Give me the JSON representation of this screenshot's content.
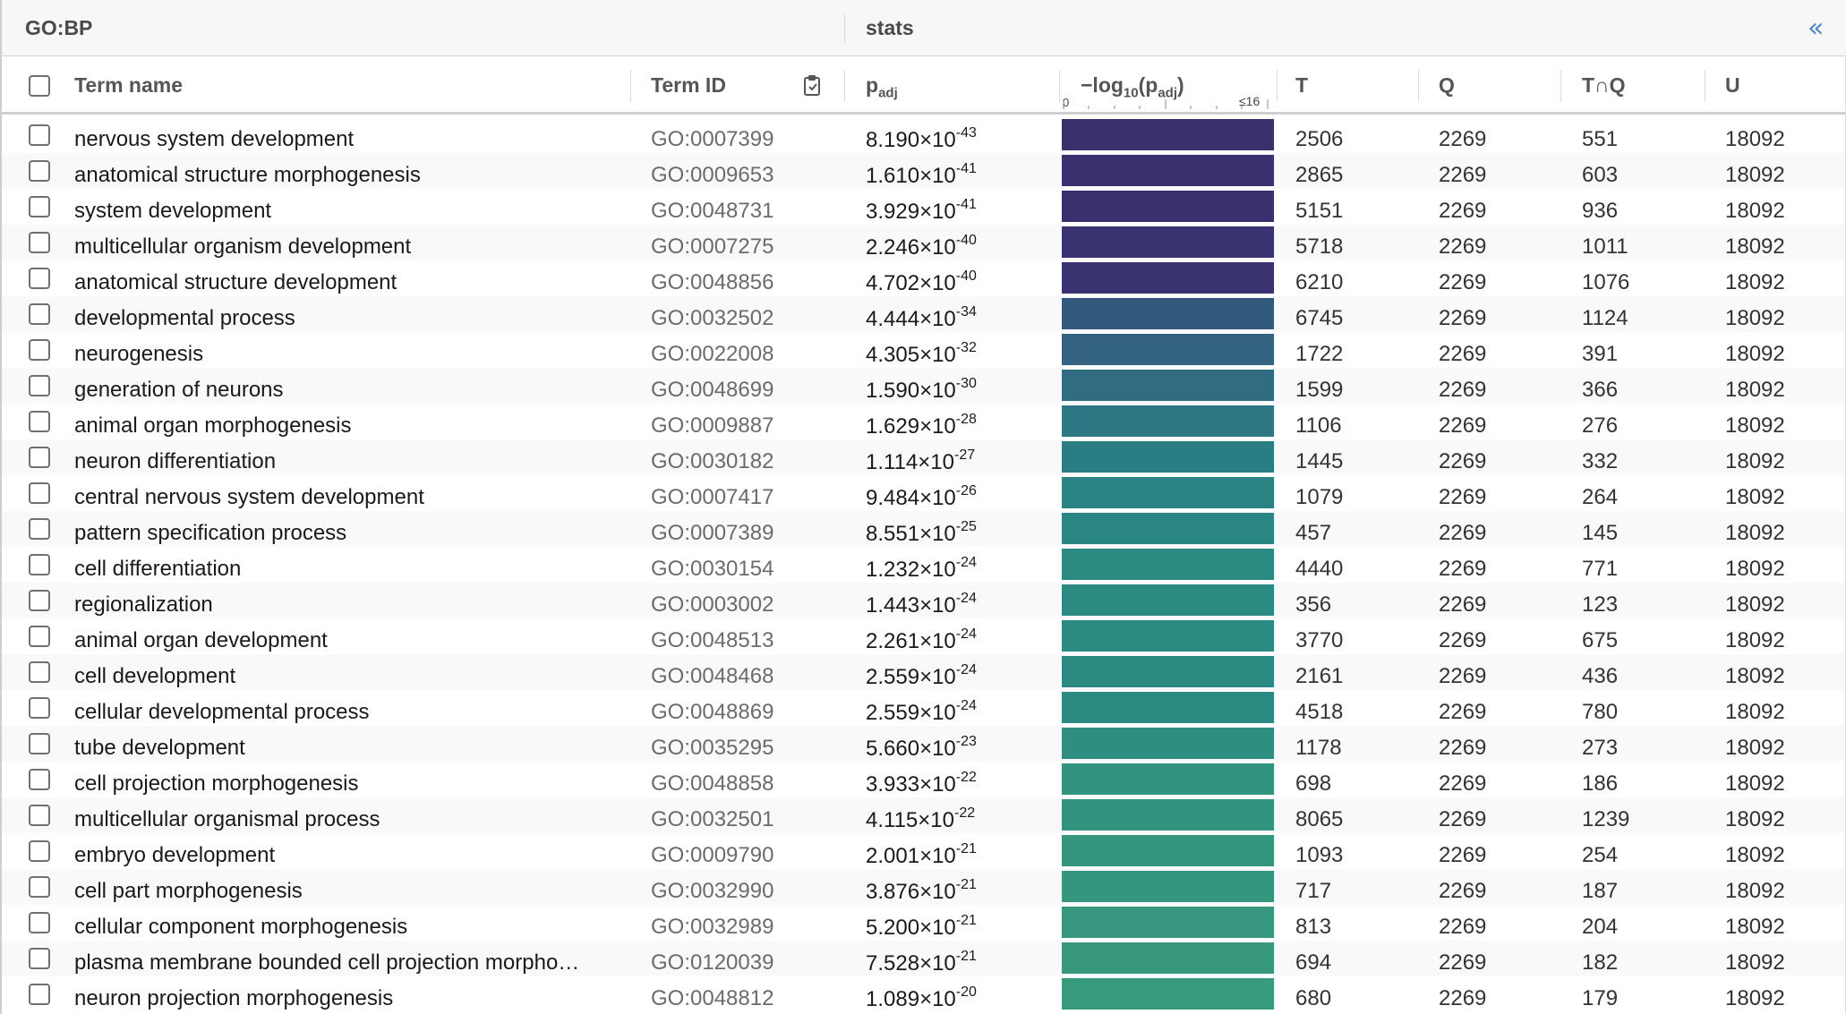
{
  "header": {
    "group_label": "GO:BP",
    "stats_label": "stats",
    "collapse_glyph": "«"
  },
  "columns": {
    "term_name": "Term name",
    "term_id": "Term ID",
    "padj_main": "p",
    "padj_sub": "adj",
    "log_prefix": "−log",
    "log_base": "10",
    "log_open": "(p",
    "log_sub": "adj",
    "log_close": ")",
    "axis_min": "0",
    "axis_max": "≤16",
    "T": "T",
    "Q": "Q",
    "TQ": "T∩Q",
    "U": "U"
  },
  "rows": [
    {
      "name": "nervous system development",
      "id": "GO:0007399",
      "mant": "8.190",
      "exp": "-43",
      "T": "2506",
      "Q": "2269",
      "TQ": "551",
      "U": "18092",
      "color": "#3b2f6d"
    },
    {
      "name": "anatomical structure morphogenesis",
      "id": "GO:0009653",
      "mant": "1.610",
      "exp": "-41",
      "T": "2865",
      "Q": "2269",
      "TQ": "603",
      "U": "18092",
      "color": "#3a3070"
    },
    {
      "name": "system development",
      "id": "GO:0048731",
      "mant": "3.929",
      "exp": "-41",
      "T": "5151",
      "Q": "2269",
      "TQ": "936",
      "U": "18092",
      "color": "#3a3070"
    },
    {
      "name": "multicellular organism development",
      "id": "GO:0007275",
      "mant": "2.246",
      "exp": "-40",
      "T": "5718",
      "Q": "2269",
      "TQ": "1011",
      "U": "18092",
      "color": "#393372"
    },
    {
      "name": "anatomical structure development",
      "id": "GO:0048856",
      "mant": "4.702",
      "exp": "-40",
      "T": "6210",
      "Q": "2269",
      "TQ": "1076",
      "U": "18092",
      "color": "#393372"
    },
    {
      "name": "developmental process",
      "id": "GO:0032502",
      "mant": "4.444",
      "exp": "-34",
      "T": "6745",
      "Q": "2269",
      "TQ": "1124",
      "U": "18092",
      "color": "#34597f"
    },
    {
      "name": "neurogenesis",
      "id": "GO:0022008",
      "mant": "4.305",
      "exp": "-32",
      "T": "1722",
      "Q": "2269",
      "TQ": "391",
      "U": "18092",
      "color": "#336380"
    },
    {
      "name": "generation of neurons",
      "id": "GO:0048699",
      "mant": "1.590",
      "exp": "-30",
      "T": "1599",
      "Q": "2269",
      "TQ": "366",
      "U": "18092",
      "color": "#306d82"
    },
    {
      "name": "animal organ morphogenesis",
      "id": "GO:0009887",
      "mant": "1.629",
      "exp": "-28",
      "T": "1106",
      "Q": "2269",
      "TQ": "276",
      "U": "18092",
      "color": "#2d7683"
    },
    {
      "name": "neuron differentiation",
      "id": "GO:0030182",
      "mant": "1.114",
      "exp": "-27",
      "T": "1445",
      "Q": "2269",
      "TQ": "332",
      "U": "18092",
      "color": "#2b7d84"
    },
    {
      "name": "central nervous system development",
      "id": "GO:0007417",
      "mant": "9.484",
      "exp": "-26",
      "T": "1079",
      "Q": "2269",
      "TQ": "264",
      "U": "18092",
      "color": "#2a8283"
    },
    {
      "name": "pattern specification process",
      "id": "GO:0007389",
      "mant": "8.551",
      "exp": "-25",
      "T": "457",
      "Q": "2269",
      "TQ": "145",
      "U": "18092",
      "color": "#2a8683"
    },
    {
      "name": "cell differentiation",
      "id": "GO:0030154",
      "mant": "1.232",
      "exp": "-24",
      "T": "4440",
      "Q": "2269",
      "TQ": "771",
      "U": "18092",
      "color": "#2b8a82"
    },
    {
      "name": "regionalization",
      "id": "GO:0003002",
      "mant": "1.443",
      "exp": "-24",
      "T": "356",
      "Q": "2269",
      "TQ": "123",
      "U": "18092",
      "color": "#2b8a82"
    },
    {
      "name": "animal organ development",
      "id": "GO:0048513",
      "mant": "2.261",
      "exp": "-24",
      "T": "3770",
      "Q": "2269",
      "TQ": "675",
      "U": "18092",
      "color": "#2b8a82"
    },
    {
      "name": "cell development",
      "id": "GO:0048468",
      "mant": "2.559",
      "exp": "-24",
      "T": "2161",
      "Q": "2269",
      "TQ": "436",
      "U": "18092",
      "color": "#2b8a82"
    },
    {
      "name": "cellular developmental process",
      "id": "GO:0048869",
      "mant": "2.559",
      "exp": "-24",
      "T": "4518",
      "Q": "2269",
      "TQ": "780",
      "U": "18092",
      "color": "#2b8a82"
    },
    {
      "name": "tube development",
      "id": "GO:0035295",
      "mant": "5.660",
      "exp": "-23",
      "T": "1178",
      "Q": "2269",
      "TQ": "273",
      "U": "18092",
      "color": "#2e8f80"
    },
    {
      "name": "cell projection morphogenesis",
      "id": "GO:0048858",
      "mant": "3.933",
      "exp": "-22",
      "T": "698",
      "Q": "2269",
      "TQ": "186",
      "U": "18092",
      "color": "#32937f"
    },
    {
      "name": "multicellular organismal process",
      "id": "GO:0032501",
      "mant": "4.115",
      "exp": "-22",
      "T": "8065",
      "Q": "2269",
      "TQ": "1239",
      "U": "18092",
      "color": "#32937f"
    },
    {
      "name": "embryo development",
      "id": "GO:0009790",
      "mant": "2.001",
      "exp": "-21",
      "T": "1093",
      "Q": "2269",
      "TQ": "254",
      "U": "18092",
      "color": "#35967e"
    },
    {
      "name": "cell part morphogenesis",
      "id": "GO:0032990",
      "mant": "3.876",
      "exp": "-21",
      "T": "717",
      "Q": "2269",
      "TQ": "187",
      "U": "18092",
      "color": "#35967e"
    },
    {
      "name": "cellular component morphogenesis",
      "id": "GO:0032989",
      "mant": "5.200",
      "exp": "-21",
      "T": "813",
      "Q": "2269",
      "TQ": "204",
      "U": "18092",
      "color": "#36977e"
    },
    {
      "name": "plasma membrane bounded cell projection morpho…",
      "id": "GO:0120039",
      "mant": "7.528",
      "exp": "-21",
      "T": "694",
      "Q": "2269",
      "TQ": "182",
      "U": "18092",
      "color": "#37987d"
    },
    {
      "name": "neuron projection morphogenesis",
      "id": "GO:0048812",
      "mant": "1.089",
      "exp": "-20",
      "T": "680",
      "Q": "2269",
      "TQ": "179",
      "U": "18092",
      "color": "#389a7d"
    }
  ]
}
